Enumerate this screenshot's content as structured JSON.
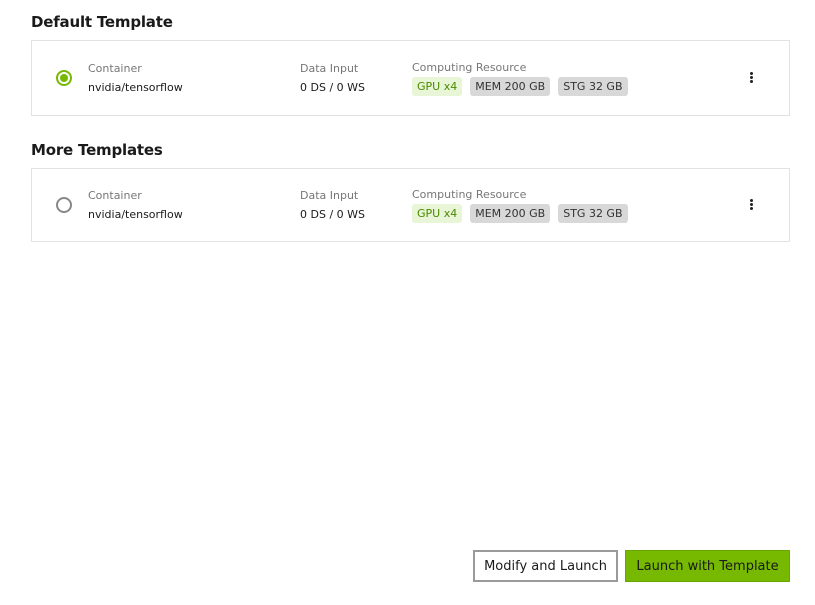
{
  "default_section": {
    "title": "Default Template",
    "templates": [
      {
        "selected": true,
        "container_label": "Container",
        "container_value": "nvidia/tensorflow",
        "data_input_label": "Data Input",
        "data_input_value": "0 DS / 0 WS",
        "resource_label": "Computing Resource",
        "chips": [
          "GPU x4",
          "MEM 200 GB",
          "STG 32 GB"
        ]
      }
    ]
  },
  "more_section": {
    "title": "More Templates",
    "templates": [
      {
        "selected": false,
        "container_label": "Container",
        "container_value": "nvidia/tensorflow",
        "data_input_label": "Data Input",
        "data_input_value": "0 DS / 0 WS",
        "resource_label": "Computing Resource",
        "chips": [
          "GPU x4",
          "MEM 200 GB",
          "STG 32 GB"
        ]
      }
    ]
  },
  "actions": {
    "modify_label": "Modify and Launch",
    "launch_label": "Launch with Template"
  },
  "colors": {
    "accent": "#76b900",
    "gpu_chip_bg": "#e8f5d6",
    "chip_bg": "#d8d8d8"
  }
}
